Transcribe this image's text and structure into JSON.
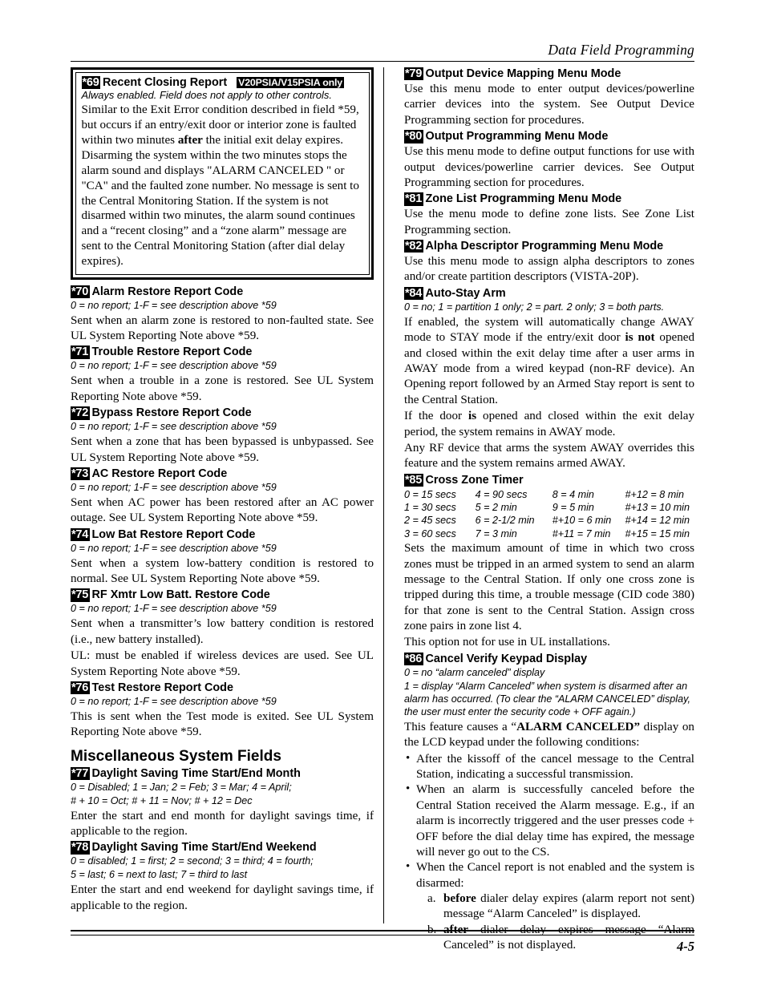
{
  "header": {
    "title": "Data Field Programming"
  },
  "footer": {
    "page_number": "4-5"
  },
  "left_column": {
    "boxed_field": {
      "badge": "*69",
      "title": "Recent Closing Report",
      "tag": "V20PSIA/V15PSIA only",
      "options": "Always enabled. Field does not apply to other controls.",
      "body": "Similar to the Exit Error condition described in field *59, but occurs if an entry/exit door or interior zone is faulted within two minutes ",
      "body_bold": "after",
      "body2": " the initial exit delay expires. Disarming the system within the two minutes stops the alarm sound and displays \"ALARM CANCELED \" or \"CA\" and the faulted zone number. No message is sent to the Central Monitoring Station. If the system is not disarmed within two minutes, the alarm sound continues and a “recent closing” and a “zone alarm” message are sent to the Central Monitoring Station (after dial delay expires)."
    },
    "fields": [
      {
        "badge": "*70",
        "title": "Alarm Restore Report Code",
        "options": "0 = no report; 1-F = see description above *59",
        "body": "Sent when an alarm zone is restored to non-faulted state. See UL System Reporting Note above *59."
      },
      {
        "badge": "*71",
        "title": "Trouble Restore Report Code",
        "options": "0 = no report; 1-F = see description above *59",
        "body": "Sent when a trouble in a zone is restored. See UL System Reporting Note above *59."
      },
      {
        "badge": "*72",
        "title": "Bypass Restore Report Code",
        "options": "0 = no report; 1-F = see description above *59",
        "body": "Sent when a zone that has been bypassed is unbypassed. See UL System Reporting Note above *59."
      },
      {
        "badge": "*73",
        "title": "AC Restore Report Code",
        "options": "0 = no report; 1-F = see description above *59",
        "body": "Sent when AC power has been restored after an AC power outage. See UL System Reporting Note above *59."
      },
      {
        "badge": "*74",
        "title": "Low Bat Restore Report Code",
        "options": "0 = no report; 1-F = see description above *59",
        "body": "Sent when a system low-battery condition is restored to normal. See UL System Reporting Note above *59."
      },
      {
        "badge": "*75",
        "title": "RF Xmtr Low Batt. Restore Code",
        "options": "0 = no report; 1-F = see description above *59",
        "body": "Sent when a transmitter’s low battery condition is restored (i.e., new battery installed).",
        "body2": "UL: must be enabled if wireless devices are used. See UL System Reporting Note above *59."
      },
      {
        "badge": "*76",
        "title": "Test Restore Report Code",
        "options": "0 = no report; 1-F = see description above *59",
        "body": "This is sent when the Test mode is exited. See UL System Reporting Note above *59."
      }
    ],
    "section_heading": "Miscellaneous System Fields",
    "misc_fields": [
      {
        "badge": "*77",
        "title": "Daylight Saving Time Start/End Month",
        "options": "0 = Disabled; 1 = Jan; 2 = Feb; 3 = Mar; 4 = April;",
        "options2": "# + 10 = Oct; # + 11 = Nov; # + 12 = Dec",
        "body": "Enter the start and end month for daylight savings time, if applicable to the region."
      },
      {
        "badge": "*78",
        "title": "Daylight Saving Time Start/End Weekend",
        "options": "0 = disabled; 1 = first; 2 = second; 3 = third; 4 = fourth;",
        "options2": "5 = last; 6 = next to last; 7 = third to last",
        "body": "Enter the start and end weekend for daylight savings time, if applicable to the region."
      }
    ]
  },
  "right_column": {
    "fields": [
      {
        "badge": "*79",
        "title": "Output Device Mapping Menu Mode",
        "body": "Use this menu mode to enter output devices/powerline carrier devices into the system. See Output Device Programming section for procedures."
      },
      {
        "badge": "*80",
        "title": "Output Programming Menu Mode",
        "body": "Use this menu mode to define output functions for use with output devices/powerline carrier devices. See Output Programming section for procedures."
      },
      {
        "badge": "*81",
        "title": "Zone List Programming Menu Mode",
        "body": "Use the menu mode to define zone lists. See Zone List Programming section."
      },
      {
        "badge": "*82",
        "title": "Alpha Descriptor Programming Menu Mode",
        "body": "Use this menu mode to assign alpha descriptors to zones and/or create partition descriptors (VISTA-20P)."
      }
    ],
    "auto_stay": {
      "badge": "*84",
      "title": "Auto-Stay Arm",
      "options": "0 = no; 1 = partition 1 only; 2 = part. 2 only; 3 = both parts.",
      "p1_a": "If enabled, the system will automatically change AWAY mode to STAY mode if the entry/exit door ",
      "p1_b1": "is",
      "p1_b2": "not",
      "p1_c": " opened and closed within the exit delay time after a user arms in AWAY mode from a wired keypad (non-RF device). An Opening report followed by an Armed Stay report is sent to the Central Station.",
      "p2_a": "If the door ",
      "p2_b": "is",
      "p2_c": " opened and closed within the exit delay period, the system remains in AWAY mode.",
      "p3": "Any RF device that arms the system AWAY overrides this feature and the system remains armed AWAY."
    },
    "cross_zone": {
      "badge": "*85",
      "title": "Cross Zone Timer",
      "option_grid": [
        [
          "0 = 15 secs",
          "4 = 90 secs",
          "8 = 4 min",
          "#+12 = 8 min"
        ],
        [
          "1 = 30 secs",
          "5 = 2 min",
          "9 = 5 min",
          "#+13 = 10 min"
        ],
        [
          "2 = 45 secs",
          "6 = 2-1/2 min",
          "#+10 = 6 min",
          "#+14 = 12 min"
        ],
        [
          "3 = 60 secs",
          "7 = 3 min",
          "#+11 = 7 min",
          "#+15 = 15 min"
        ]
      ],
      "body": "Sets the maximum amount of time in which two cross zones must be tripped in an armed system to send an alarm message to the Central Station. If only one cross zone is tripped during this time, a trouble message (CID code 380) for that zone is sent to the Central Station. Assign cross zone pairs in zone list 4.",
      "body2": "This option not for use in UL installations."
    },
    "cancel_verify": {
      "badge": "*86",
      "title": "Cancel Verify Keypad Display",
      "options": "0 = no “alarm canceled” display",
      "options2": "1 = display “Alarm Canceled” when system is disarmed after an alarm has occurred. (To clear the “ALARM CANCELED” display, the user must enter the security code + OFF again.)",
      "intro_a": "This feature causes a “",
      "intro_b": "ALARM CANCELED”",
      "intro_c": " display on the LCD keypad under the following conditions:",
      "bullets": [
        "After the kissoff of the cancel message to the Central Station, indicating a successful transmission.",
        "When an alarm is successfully canceled before the Central Station received the Alarm message. E.g., if an alarm is incorrectly triggered and the user presses code + OFF before the dial delay time has expired, the message will never go out to the CS."
      ],
      "bullet3_text": "When the Cancel report is not enabled and the system is disarmed:",
      "sub_items": [
        {
          "label": "a.",
          "bold": "before",
          "text": " dialer delay expires (alarm report not sent) message “Alarm Canceled” is displayed."
        },
        {
          "label": "b.",
          "bold": "after",
          "text": " dialer delay expires message “Alarm Canceled” is not displayed."
        }
      ]
    }
  }
}
